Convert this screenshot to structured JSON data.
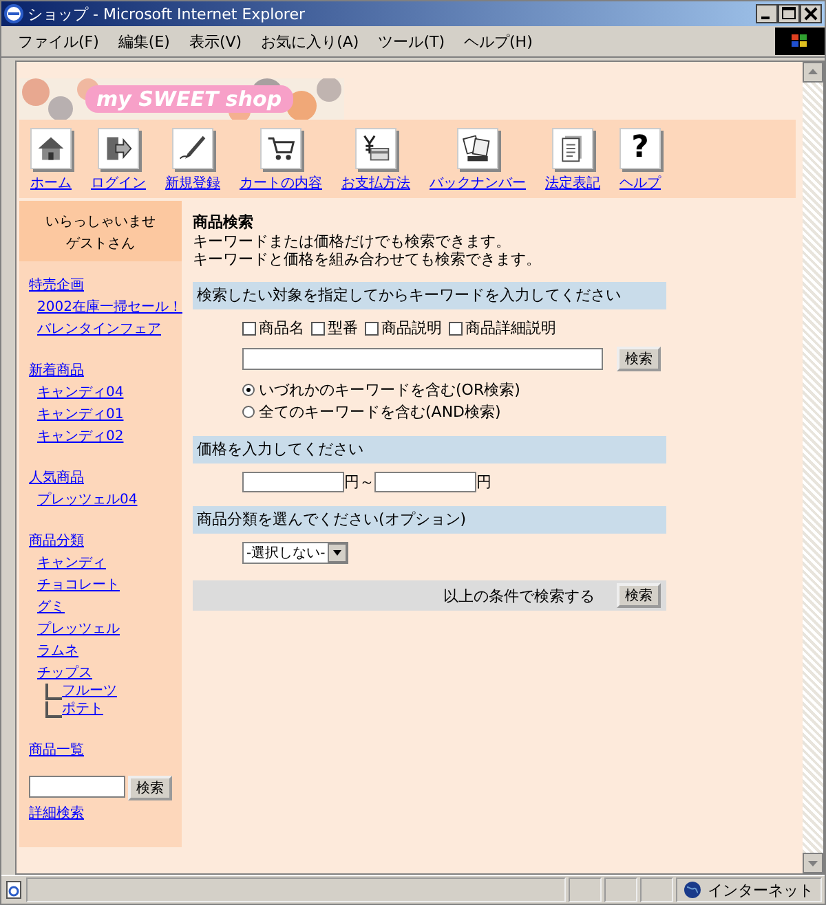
{
  "window": {
    "title": "ショップ - Microsoft Internet Explorer"
  },
  "menu": [
    "ファイル(F)",
    "編集(E)",
    "表示(V)",
    "お気に入り(A)",
    "ツール(T)",
    "ヘルプ(H)"
  ],
  "logo": {
    "text": "my SWEET shop"
  },
  "nav": [
    {
      "kind": "home",
      "label": "ホーム"
    },
    {
      "kind": "login",
      "label": "ログイン"
    },
    {
      "kind": "signup",
      "label": "新規登録"
    },
    {
      "kind": "cart",
      "label": "カートの内容"
    },
    {
      "kind": "payment",
      "label": "お支払方法"
    },
    {
      "kind": "magazine",
      "label": "バックナンバー"
    },
    {
      "kind": "legal",
      "label": "法定表記"
    },
    {
      "kind": "help",
      "label": "ヘルプ",
      "glyph": "?"
    }
  ],
  "sidebar": {
    "greeting": [
      "いらっしゃいませ",
      "ゲストさん"
    ],
    "sections": [
      {
        "heading": "特売企画",
        "items": [
          {
            "label": "2002在庫一掃セール！"
          },
          {
            "label": "バレンタインフェア"
          }
        ]
      },
      {
        "heading": "新着商品",
        "items": [
          {
            "label": "キャンディ04"
          },
          {
            "label": "キャンディ01"
          },
          {
            "label": "キャンディ02"
          }
        ]
      },
      {
        "heading": "人気商品",
        "items": [
          {
            "label": "プレッツェル04"
          }
        ]
      },
      {
        "heading": "商品分類",
        "items": [
          {
            "label": "キャンディ"
          },
          {
            "label": "チョコレート"
          },
          {
            "label": "グミ"
          },
          {
            "label": "プレッツェル"
          },
          {
            "label": "ラムネ"
          },
          {
            "label": "チップス",
            "children": [
              {
                "label": "フルーツ"
              },
              {
                "label": "ポテト"
              }
            ]
          }
        ]
      },
      {
        "heading": "商品一覧"
      }
    ],
    "search_button": "検索",
    "detail_link": "詳細検索"
  },
  "main": {
    "title": "商品検索",
    "description": [
      "キーワードまたは価格だけでも検索できます。",
      "キーワードと価格を組み合わせても検索できます。"
    ],
    "keyword_heading": "検索したい対象を指定してからキーワードを入力してください",
    "targets": [
      {
        "label": "商品名",
        "checked": false
      },
      {
        "label": "型番",
        "checked": false
      },
      {
        "label": "商品説明",
        "checked": false
      },
      {
        "label": "商品詳細説明",
        "checked": false
      }
    ],
    "keyword_button": "検索",
    "modes": [
      {
        "label": "いづれかのキーワードを含む(OR検索)",
        "selected": true
      },
      {
        "label": "全てのキーワードを含む(AND検索)",
        "selected": false
      }
    ],
    "price_heading": "価格を入力してください",
    "price_unit_from": "円～",
    "price_unit_to": "円",
    "category_heading": "商品分類を選んでください(オプション)",
    "category_value": "-選択しない-",
    "submit_text": "以上の条件で検索する",
    "submit_button": "検索"
  },
  "status_bar": {
    "zone": "インターネット"
  }
}
